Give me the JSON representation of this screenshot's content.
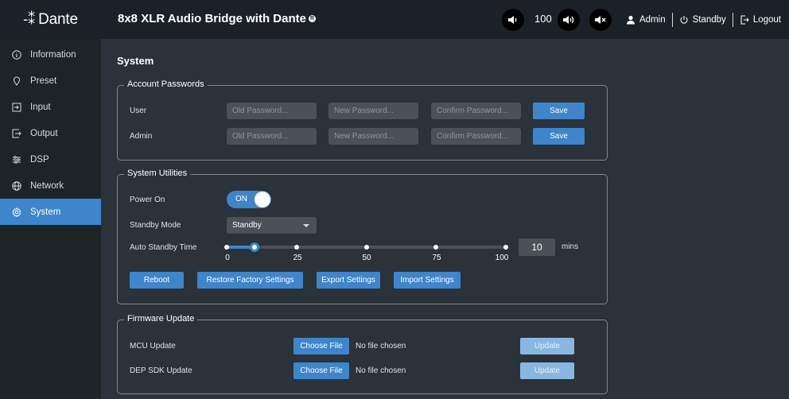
{
  "brand": {
    "logo_text": "Dante"
  },
  "header": {
    "title": "8x8 XLR Audio Bridge with Dante",
    "volume_value": "100",
    "user_label": "Admin",
    "standby_label": "Standby",
    "logout_label": "Logout"
  },
  "sidebar": {
    "items": [
      {
        "label": "Information",
        "icon": "info-icon"
      },
      {
        "label": "Preset",
        "icon": "preset-icon"
      },
      {
        "label": "Input",
        "icon": "input-icon"
      },
      {
        "label": "Output",
        "icon": "output-icon"
      },
      {
        "label": "DSP",
        "icon": "dsp-icon"
      },
      {
        "label": "Network",
        "icon": "network-icon"
      },
      {
        "label": "System",
        "icon": "system-icon",
        "active": true
      }
    ]
  },
  "page": {
    "title": "System"
  },
  "passwords": {
    "legend": "Account Passwords",
    "rows": [
      {
        "label": "User",
        "old_placeholder": "Old Password...",
        "new_placeholder": "New Password...",
        "confirm_placeholder": "Confirm Password...",
        "save_label": "Save"
      },
      {
        "label": "Admin",
        "old_placeholder": "Old Password...",
        "new_placeholder": "New Password...",
        "confirm_placeholder": "Confirm Password...",
        "save_label": "Save"
      }
    ]
  },
  "utilities": {
    "legend": "System Utilities",
    "power_label": "Power On",
    "power_state": "ON",
    "standby_mode_label": "Standby Mode",
    "standby_mode_value": "Standby",
    "auto_standby_label": "Auto Standby Time",
    "auto_standby_value": 10,
    "auto_standby_value_text": "10",
    "auto_standby_unit": "mins",
    "slider_ticks": [
      "0",
      "25",
      "50",
      "75",
      "100"
    ],
    "buttons": {
      "reboot": "Reboot",
      "restore": "Restore Factory Settings",
      "export": "Export Settings",
      "import": "Import Settings"
    }
  },
  "firmware": {
    "legend": "Firmware Update",
    "rows": [
      {
        "label": "MCU Update",
        "choose_label": "Choose File",
        "file_status": "No file chosen",
        "update_label": "Update"
      },
      {
        "label": "DEP SDK Update",
        "choose_label": "Choose File",
        "file_status": "No file chosen",
        "update_label": "Update"
      }
    ]
  },
  "colors": {
    "accent": "#3e85cc",
    "header_bg": "#1b2227",
    "sidebar_bg": "#1d2428",
    "main_bg": "#2a3339"
  }
}
